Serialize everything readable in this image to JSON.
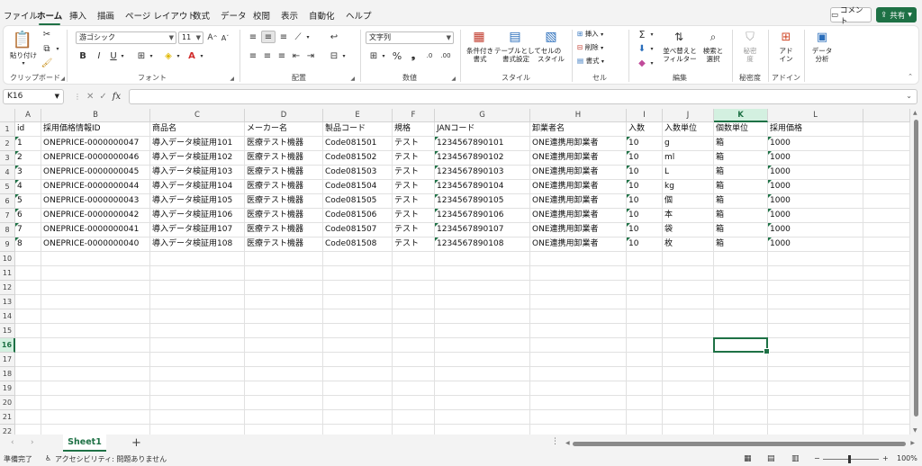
{
  "menu": {
    "tabs": [
      "ファイル",
      "ホーム",
      "挿入",
      "描画",
      "ページ レイアウト",
      "数式",
      "データ",
      "校閲",
      "表示",
      "自動化",
      "ヘルプ"
    ],
    "comment_label": "コメント",
    "share_label": "共有"
  },
  "ribbon": {
    "clipboard": {
      "paste": "貼り付け",
      "label": "クリップボード"
    },
    "font": {
      "name": "游ゴシック",
      "size": "11",
      "label": "フォント"
    },
    "alignment": {
      "label": "配置"
    },
    "number": {
      "format": "文字列",
      "label": "数値"
    },
    "styles": {
      "cond": "条件付き\n書式",
      "table": "テーブルとして\n書式設定",
      "cell": "セルの\nスタイル",
      "label": "スタイル"
    },
    "cells": {
      "insert": "挿入",
      "delete": "削除",
      "format": "書式",
      "label": "セル"
    },
    "editing": {
      "sort": "並べ替えと\nフィルター",
      "find": "検索と\n選択",
      "label": "編集"
    },
    "sensitivity": {
      "btn": "秘密\n度",
      "label": "秘密度"
    },
    "addins": {
      "btn": "アド\nイン",
      "label": "アドイン"
    },
    "analysis": {
      "btn": "データ\n分析"
    }
  },
  "formula_bar": {
    "name_box": "K16",
    "value": ""
  },
  "grid": {
    "columns": [
      "A",
      "B",
      "C",
      "D",
      "E",
      "F",
      "G",
      "H",
      "I",
      "J",
      "K",
      "L"
    ],
    "selected_column": "K",
    "selected_row": "16",
    "row_numbers": [
      "1",
      "2",
      "3",
      "4",
      "5",
      "6",
      "7",
      "8",
      "9",
      "10",
      "11",
      "12",
      "13",
      "14",
      "15",
      "16",
      "17",
      "18",
      "19",
      "20",
      "21",
      "22"
    ],
    "header": [
      "id",
      "採用価格情報ID",
      "商品名",
      "メーカー名",
      "製品コード",
      "規格",
      "JANコード",
      "卸業者名",
      "入数",
      "入数単位",
      "個数単位",
      "採用価格"
    ],
    "rows": [
      [
        "1",
        "ONEPRICE-0000000047",
        "導入データ検証用101",
        "医療テスト機器",
        "Code081501",
        "テスト",
        "1234567890101",
        "ONE連携用卸業者",
        "10",
        "g",
        "箱",
        "1000"
      ],
      [
        "2",
        "ONEPRICE-0000000046",
        "導入データ検証用102",
        "医療テスト機器",
        "Code081502",
        "テスト",
        "1234567890102",
        "ONE連携用卸業者",
        "10",
        "ml",
        "箱",
        "1000"
      ],
      [
        "3",
        "ONEPRICE-0000000045",
        "導入データ検証用103",
        "医療テスト機器",
        "Code081503",
        "テスト",
        "1234567890103",
        "ONE連携用卸業者",
        "10",
        "L",
        "箱",
        "1000"
      ],
      [
        "4",
        "ONEPRICE-0000000044",
        "導入データ検証用104",
        "医療テスト機器",
        "Code081504",
        "テスト",
        "1234567890104",
        "ONE連携用卸業者",
        "10",
        "kg",
        "箱",
        "1000"
      ],
      [
        "5",
        "ONEPRICE-0000000043",
        "導入データ検証用105",
        "医療テスト機器",
        "Code081505",
        "テスト",
        "1234567890105",
        "ONE連携用卸業者",
        "10",
        "個",
        "箱",
        "1000"
      ],
      [
        "6",
        "ONEPRICE-0000000042",
        "導入データ検証用106",
        "医療テスト機器",
        "Code081506",
        "テスト",
        "1234567890106",
        "ONE連携用卸業者",
        "10",
        "本",
        "箱",
        "1000"
      ],
      [
        "7",
        "ONEPRICE-0000000041",
        "導入データ検証用107",
        "医療テスト機器",
        "Code081507",
        "テスト",
        "1234567890107",
        "ONE連携用卸業者",
        "10",
        "袋",
        "箱",
        "1000"
      ],
      [
        "8",
        "ONEPRICE-0000000040",
        "導入データ検証用108",
        "医療テスト機器",
        "Code081508",
        "テスト",
        "1234567890108",
        "ONE連携用卸業者",
        "10",
        "枚",
        "箱",
        "1000"
      ]
    ]
  },
  "sheets": {
    "active": "Sheet1"
  },
  "status": {
    "ready": "準備完了",
    "accessibility": "アクセシビリティ: 問題ありません",
    "zoom": "100%"
  },
  "colors": {
    "accent": "#1e7145"
  }
}
